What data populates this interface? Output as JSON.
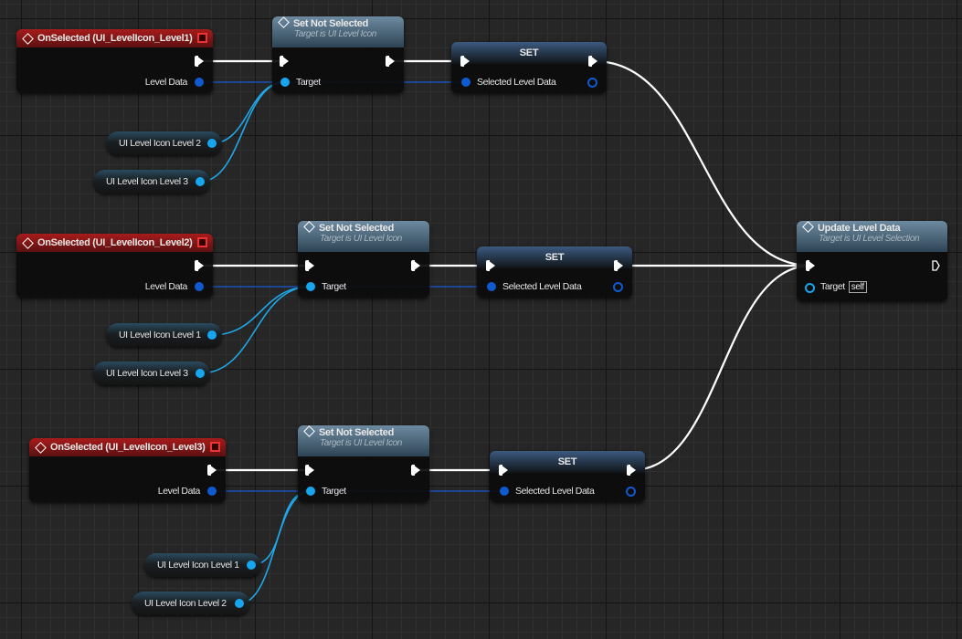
{
  "colors": {
    "exec": "#ffffff",
    "level_data_wire": "#1a50b8",
    "icon_wire": "#1fa8ea",
    "event_header": "#a81c1c",
    "function_header": "#6d8aa0"
  },
  "groups": [
    {
      "event": {
        "title": "OnSelected (UI_LevelIcon_Level1)",
        "pin_label": "Level Data"
      },
      "set_not_selected": {
        "title": "Set Not Selected",
        "subtitle": "Target is UI Level Icon",
        "pin_label": "Target"
      },
      "set": {
        "title": "SET",
        "pin_label": "Selected Level Data"
      },
      "vars": [
        "UI Level Icon Level 2",
        "UI Level Icon Level 3"
      ]
    },
    {
      "event": {
        "title": "OnSelected (UI_LevelIcon_Level2)",
        "pin_label": "Level Data"
      },
      "set_not_selected": {
        "title": "Set Not Selected",
        "subtitle": "Target is UI Level Icon",
        "pin_label": "Target"
      },
      "set": {
        "title": "SET",
        "pin_label": "Selected Level Data"
      },
      "vars": [
        "UI Level Icon Level 1",
        "UI Level Icon Level 3"
      ]
    },
    {
      "event": {
        "title": "OnSelected (UI_LevelIcon_Level3)",
        "pin_label": "Level Data"
      },
      "set_not_selected": {
        "title": "Set Not Selected",
        "subtitle": "Target is UI Level Icon",
        "pin_label": "Target"
      },
      "set": {
        "title": "SET",
        "pin_label": "Selected Level Data"
      },
      "vars": [
        "UI Level Icon Level 1",
        "UI Level Icon Level 2"
      ]
    }
  ],
  "update": {
    "title": "Update Level Data",
    "subtitle": "Target is UI Level Selection",
    "pin_label": "Target",
    "self_label": "self"
  }
}
